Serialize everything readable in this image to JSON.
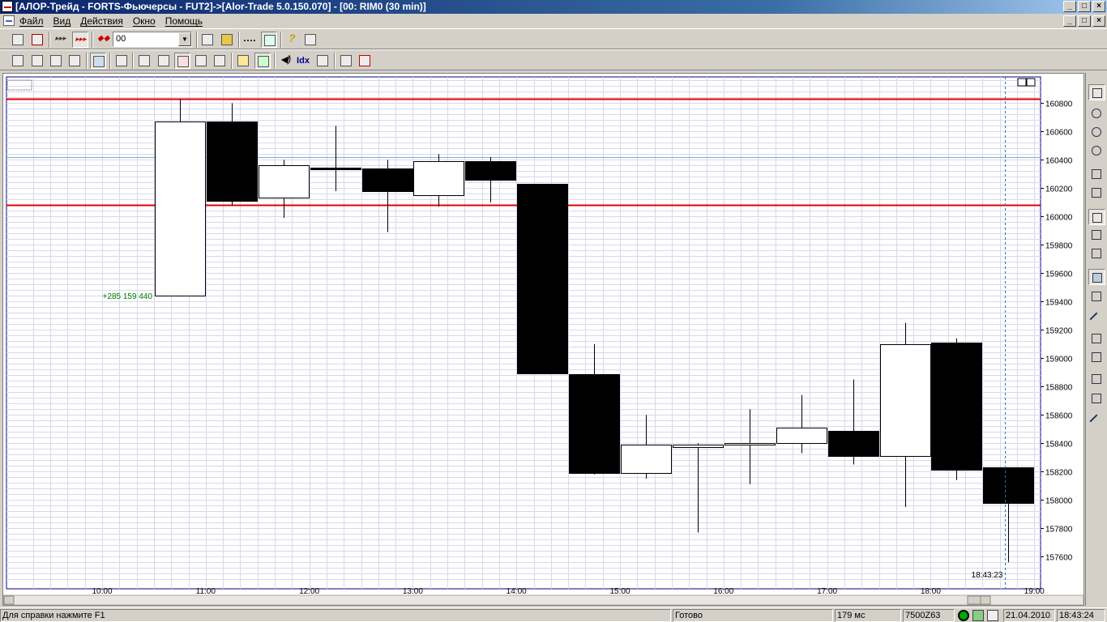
{
  "window": {
    "title": "[АЛОР-Трейд - FORTS-Фьючерсы - FUT2]->[Alor-Trade 5.0.150.070] - [00: RIM0 (30 min)]",
    "min_label": "_",
    "max_label": "□",
    "close_label": "×"
  },
  "menu": {
    "items": [
      "Файл",
      "Вид",
      "Действия",
      "Окно",
      "Помощь"
    ]
  },
  "toolbar1": {
    "combo_value": "00",
    "icons": [
      "order-icon",
      "cancel-order-icon",
      "autotrade-icon",
      "autotrade-active-icon",
      "group-icon",
      "new-chart-icon",
      "open-icon",
      "separator-icon",
      "window-icon",
      "help-icon",
      "home-icon"
    ]
  },
  "toolbar2": {
    "idx_label": "Idx",
    "icons": [
      "quotes-icon",
      "orders-icon",
      "trades-icon",
      "positions-icon",
      "instruments-icon",
      "table-icon",
      "portfolio-icon",
      "money-icon",
      "news-icon",
      "deals-icon",
      "handshake-icon",
      "alerts-icon",
      "sound-icon",
      "idx-icon",
      "report-icon",
      "settings-icon",
      "connect-icon"
    ]
  },
  "chart_data": {
    "type": "candlestick",
    "instrument": "RIM0",
    "timeframe": "30 min",
    "y_ticks": [
      160800,
      160600,
      160400,
      160200,
      160000,
      159800,
      159600,
      159400,
      159200,
      159000,
      158800,
      158600,
      158400,
      158200,
      158000,
      157800,
      157600
    ],
    "x_labels": [
      "10:00",
      "11:00",
      "12:00",
      "13:00",
      "14:00",
      "15:00",
      "16:00",
      "17:00",
      "18:00",
      "19:00"
    ],
    "candles": [
      {
        "time": "10:30",
        "open": 159440,
        "high": 160830,
        "low": 159440,
        "close": 160670
      },
      {
        "time": "11:00",
        "open": 160670,
        "high": 160800,
        "low": 160080,
        "close": 160110
      },
      {
        "time": "11:30",
        "open": 160130,
        "high": 160400,
        "low": 159990,
        "close": 160360
      },
      {
        "time": "12:00",
        "open": 160345,
        "high": 160640,
        "low": 160180,
        "close": 160335
      },
      {
        "time": "12:30",
        "open": 160340,
        "high": 160400,
        "low": 159890,
        "close": 160180
      },
      {
        "time": "13:00",
        "open": 160150,
        "high": 160440,
        "low": 160070,
        "close": 160390
      },
      {
        "time": "13:30",
        "open": 160390,
        "high": 160420,
        "low": 160100,
        "close": 160260
      },
      {
        "time": "14:00",
        "open": 160230,
        "high": 160230,
        "low": 158890,
        "close": 158890
      },
      {
        "time": "14:30",
        "open": 158890,
        "high": 159100,
        "low": 158180,
        "close": 158190
      },
      {
        "time": "15:00",
        "open": 158190,
        "high": 158600,
        "low": 158150,
        "close": 158390
      },
      {
        "time": "15:30",
        "open": 158370,
        "high": 158400,
        "low": 157770,
        "close": 158390
      },
      {
        "time": "16:00",
        "open": 158390,
        "high": 158640,
        "low": 158110,
        "close": 158400
      },
      {
        "time": "16:30",
        "open": 158400,
        "high": 158740,
        "low": 158330,
        "close": 158510
      },
      {
        "time": "17:00",
        "open": 158490,
        "high": 158850,
        "low": 158250,
        "close": 158310
      },
      {
        "time": "17:30",
        "open": 158310,
        "high": 159250,
        "low": 157950,
        "close": 159100
      },
      {
        "time": "18:00",
        "open": 159110,
        "high": 159140,
        "low": 158140,
        "close": 158210
      },
      {
        "time": "18:30",
        "open": 158230,
        "high": 158230,
        "low": 157560,
        "close": 157980
      }
    ],
    "levels": [
      {
        "price": 160830,
        "color": "#e00000"
      },
      {
        "price": 160080,
        "color": "#e00000"
      },
      {
        "price": 160420,
        "color": "#7ab0c8"
      }
    ],
    "annotation": {
      "text": "+285  159 440",
      "price": 159440,
      "color": "#008000"
    },
    "cursor_time": "18:43:23",
    "ylim": [
      157430,
      160985
    ],
    "grid": true
  },
  "right_toolbar": {
    "icons": [
      "chart-type-icon",
      "zoom-icon",
      "zoom-out-icon",
      "zoom-in-icon",
      "scale-h-icon",
      "scale-v-icon",
      "fit-icon",
      "expand-icon",
      "compress-icon",
      "order-tool-icon",
      "level-tool-icon",
      "line-tool-icon",
      "grid-icon",
      "table-grid-icon",
      "hline-icon",
      "vline-icon",
      "diag-icon"
    ]
  },
  "statusbar": {
    "help": "Для справки нажмите F1",
    "state": "Готово",
    "latency": "179 мс",
    "account": "7500Z63",
    "date": "21.04.2010",
    "time": "18:43:24"
  }
}
